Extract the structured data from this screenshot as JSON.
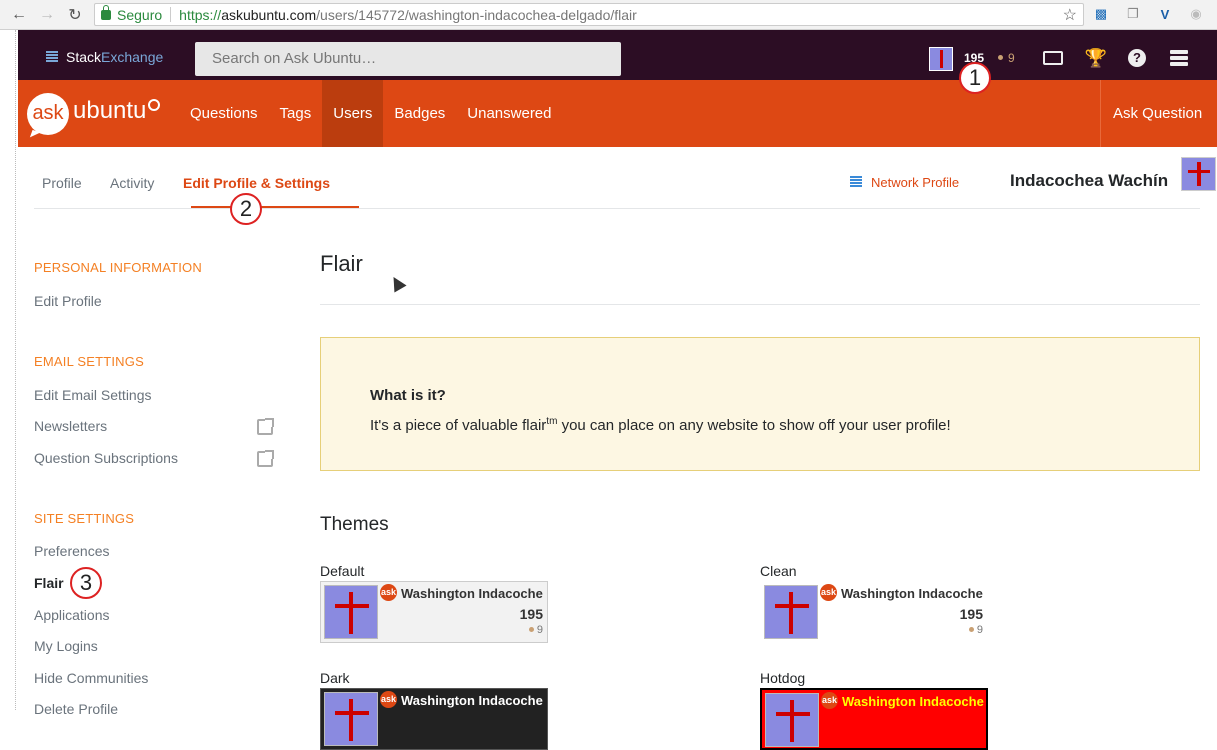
{
  "browser": {
    "secure_label": "Seguro",
    "url_scheme": "https://",
    "url_host": "askubuntu.com",
    "url_path": "/users/145772/washington-indacochea-delgado/flair"
  },
  "topbar": {
    "logo_stack": "Stack",
    "logo_exchange": "Exchange",
    "search_placeholder": "Search on Ask Ubuntu…",
    "reputation": "195",
    "bronze_count": "9"
  },
  "sitebar": {
    "logo_ask": "ask",
    "logo_ubuntu": "ubuntu",
    "nav": [
      "Questions",
      "Tags",
      "Users",
      "Badges",
      "Unanswered"
    ],
    "ask_question": "Ask Question"
  },
  "callouts": [
    "1",
    "2",
    "3"
  ],
  "subnav": {
    "tabs": [
      "Profile",
      "Activity",
      "Edit Profile & Settings"
    ],
    "network_profile": "Network Profile",
    "user_name": "Indacochea Wachín"
  },
  "sidebar": {
    "personal_head": "PERSONAL INFORMATION",
    "edit_profile": "Edit Profile",
    "email_head": "EMAIL SETTINGS",
    "edit_email": "Edit Email Settings",
    "newsletters": "Newsletters",
    "question_subscriptions": "Question Subscriptions",
    "site_head": "SITE SETTINGS",
    "preferences": "Preferences",
    "flair": "Flair",
    "applications": "Applications",
    "my_logins": "My Logins",
    "hide_communities": "Hide Communities",
    "delete_profile": "Delete Profile"
  },
  "main": {
    "title": "Flair",
    "info_question": "What is it?",
    "info_text_before": "It's a piece of valuable flair",
    "info_tm": "tm",
    "info_text_after": " you can place on any website to show off your user profile!",
    "themes_heading": "Themes",
    "themes": [
      {
        "label": "Default",
        "name": "Washington Indacoche",
        "rep": "195",
        "badges": "9",
        "site_icon": "ask"
      },
      {
        "label": "Clean",
        "name": "Washington Indacoche",
        "rep": "195",
        "badges": "9",
        "site_icon": "ask"
      },
      {
        "label": "Dark",
        "name": "Washington Indacoche",
        "site_icon": "ask"
      },
      {
        "label": "Hotdog",
        "name": "Washington Indacoche",
        "site_icon": "ask"
      }
    ]
  },
  "colors": {
    "topbar_bg": "#2c0d24",
    "brand_orange": "#dd4814",
    "nav_active": "#bb3d0e",
    "section_head": "#f48024",
    "callout_ring": "#dd2222"
  }
}
